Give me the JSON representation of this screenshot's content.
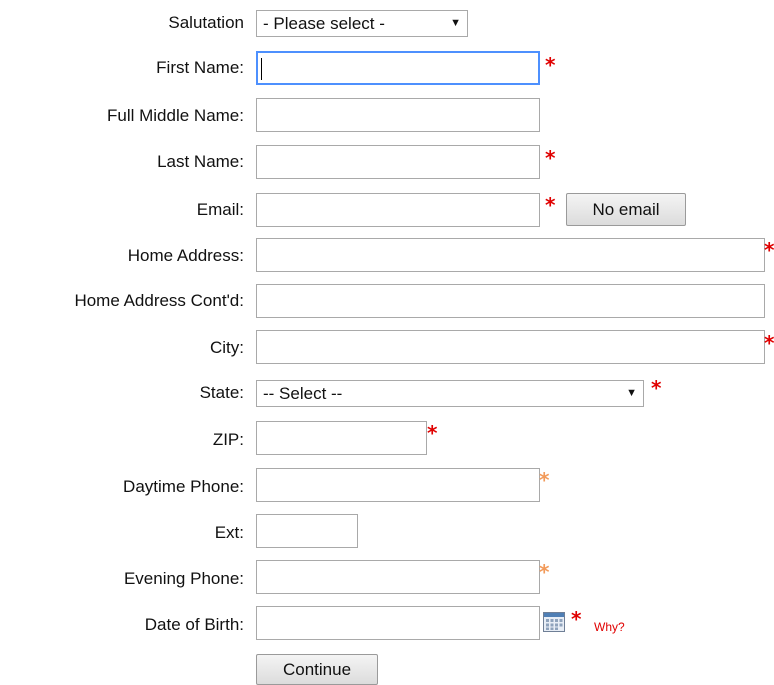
{
  "form": {
    "salutation": {
      "label": "Salutation",
      "selected": "- Please select -"
    },
    "first_name": {
      "label": "First Name:",
      "value": ""
    },
    "middle_name": {
      "label": "Full Middle Name:",
      "value": ""
    },
    "last_name": {
      "label": "Last Name:",
      "value": ""
    },
    "email": {
      "label": "Email:",
      "value": "",
      "no_email_label": "No email"
    },
    "home_address": {
      "label": "Home Address:",
      "value": ""
    },
    "home_address_cont": {
      "label": "Home Address Cont'd:",
      "value": ""
    },
    "city": {
      "label": "City:",
      "value": ""
    },
    "state": {
      "label": "State:",
      "selected": "-- Select --"
    },
    "zip": {
      "label": "ZIP:",
      "value": ""
    },
    "daytime_phone": {
      "label": "Daytime Phone:",
      "value": ""
    },
    "ext": {
      "label": "Ext:",
      "value": ""
    },
    "evening_phone": {
      "label": "Evening Phone:",
      "value": ""
    },
    "dob": {
      "label": "Date of Birth:",
      "value": "",
      "why_label": "Why?",
      "calendar_icon": "calendar-icon"
    },
    "required_marker": "*",
    "continue_label": "Continue"
  },
  "colors": {
    "required": "#e00000",
    "optional_required": "#f29a5a",
    "focus_border": "#4d90fe",
    "input_border": "#a9a9a9"
  }
}
